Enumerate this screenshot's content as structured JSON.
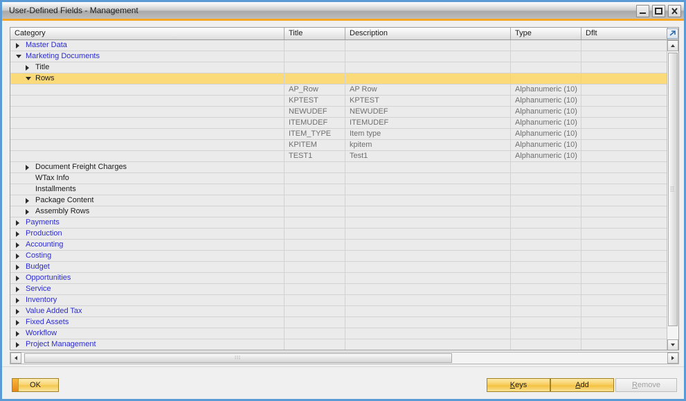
{
  "window": {
    "title": "User-Defined Fields - Management",
    "controls": [
      {
        "name": "minimize",
        "glyph": "minimize-icon"
      },
      {
        "name": "maximize",
        "glyph": "maximize-icon"
      },
      {
        "name": "close",
        "glyph": "close-icon"
      }
    ],
    "accent_color": "#f5a623",
    "border_color": "#5b9bd5"
  },
  "grid": {
    "columns": [
      {
        "key": "category",
        "label": "Category"
      },
      {
        "key": "title",
        "label": "Title"
      },
      {
        "key": "description",
        "label": "Description"
      },
      {
        "key": "type",
        "label": "Type"
      },
      {
        "key": "dflt",
        "label": "Dflt"
      }
    ],
    "expand_icon": "expand-arrow-icon",
    "selection_color": "#fbda79",
    "rows": [
      {
        "kind": "node",
        "level": 0,
        "label": "Master Data",
        "style": "link",
        "expander": "right",
        "selected": false
      },
      {
        "kind": "node",
        "level": 0,
        "label": "Marketing Documents",
        "style": "link",
        "expander": "down",
        "selected": false
      },
      {
        "kind": "node",
        "level": 1,
        "label": "Title",
        "style": "plain",
        "expander": "right",
        "selected": false
      },
      {
        "kind": "node",
        "level": 1,
        "label": "Rows",
        "style": "plain",
        "expander": "down",
        "selected": true
      },
      {
        "kind": "field",
        "title": "AP_Row",
        "description": "AP Row",
        "type": "Alphanumeric (10)",
        "dflt": ""
      },
      {
        "kind": "field",
        "title": "KPTEST",
        "description": "KPTEST",
        "type": "Alphanumeric (10)",
        "dflt": ""
      },
      {
        "kind": "field",
        "title": "NEWUDEF",
        "description": "NEWUDEF",
        "type": "Alphanumeric (10)",
        "dflt": ""
      },
      {
        "kind": "field",
        "title": "ITEMUDEF",
        "description": "ITEMUDEF",
        "type": "Alphanumeric (10)",
        "dflt": ""
      },
      {
        "kind": "field",
        "title": "ITEM_TYPE",
        "description": "Item type",
        "type": "Alphanumeric (10)",
        "dflt": ""
      },
      {
        "kind": "field",
        "title": "KPITEM",
        "description": "kpitem",
        "type": "Alphanumeric (10)",
        "dflt": ""
      },
      {
        "kind": "field",
        "title": "TEST1",
        "description": "Test1",
        "type": "Alphanumeric (10)",
        "dflt": ""
      },
      {
        "kind": "node",
        "level": 1,
        "label": "Document Freight Charges",
        "style": "plain",
        "expander": "right",
        "selected": false
      },
      {
        "kind": "node",
        "level": 1,
        "label": "WTax Info",
        "style": "plain",
        "expander": "none",
        "selected": false
      },
      {
        "kind": "node",
        "level": 1,
        "label": "Installments",
        "style": "plain",
        "expander": "none",
        "selected": false
      },
      {
        "kind": "node",
        "level": 1,
        "label": "Package Content",
        "style": "plain",
        "expander": "right",
        "selected": false
      },
      {
        "kind": "node",
        "level": 1,
        "label": "Assembly Rows",
        "style": "plain",
        "expander": "right",
        "selected": false
      },
      {
        "kind": "node",
        "level": 0,
        "label": "Payments",
        "style": "link",
        "expander": "right",
        "selected": false
      },
      {
        "kind": "node",
        "level": 0,
        "label": "Production",
        "style": "link",
        "expander": "right",
        "selected": false
      },
      {
        "kind": "node",
        "level": 0,
        "label": "Accounting",
        "style": "link",
        "expander": "right",
        "selected": false
      },
      {
        "kind": "node",
        "level": 0,
        "label": "Costing",
        "style": "link",
        "expander": "right",
        "selected": false
      },
      {
        "kind": "node",
        "level": 0,
        "label": "Budget",
        "style": "link",
        "expander": "right",
        "selected": false
      },
      {
        "kind": "node",
        "level": 0,
        "label": "Opportunities",
        "style": "link",
        "expander": "right",
        "selected": false
      },
      {
        "kind": "node",
        "level": 0,
        "label": "Service",
        "style": "link",
        "expander": "right",
        "selected": false
      },
      {
        "kind": "node",
        "level": 0,
        "label": "Inventory",
        "style": "link",
        "expander": "right",
        "selected": false
      },
      {
        "kind": "node",
        "level": 0,
        "label": "Value Added Tax",
        "style": "link",
        "expander": "right",
        "selected": false
      },
      {
        "kind": "node",
        "level": 0,
        "label": "Fixed Assets",
        "style": "link",
        "expander": "right",
        "selected": false
      },
      {
        "kind": "node",
        "level": 0,
        "label": "Workflow",
        "style": "link",
        "expander": "right",
        "selected": false
      },
      {
        "kind": "node",
        "level": 0,
        "label": "Project Management",
        "style": "link",
        "expander": "right",
        "selected": false
      },
      {
        "kind": "blank"
      }
    ]
  },
  "scrollbars": {
    "vertical": {
      "up": "scroll-up-icon",
      "down": "scroll-down-icon"
    },
    "horizontal": {
      "left": "scroll-left-icon",
      "right": "scroll-right-icon"
    }
  },
  "footer": {
    "ok_label": "OK",
    "keys_label": "Keys",
    "keys_mnemonic": "K",
    "add_label": "Add",
    "add_mnemonic": "A",
    "remove_label": "Remove",
    "remove_mnemonic": "R",
    "remove_enabled": false
  }
}
